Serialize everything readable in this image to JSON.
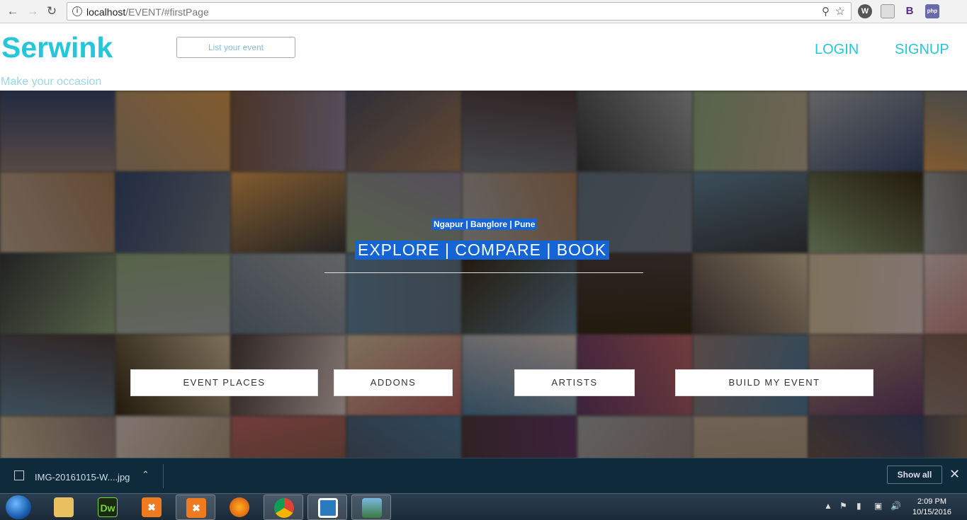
{
  "browser": {
    "url_host": "localhost",
    "url_path": "/EVENT/#firstPage",
    "extensions": [
      "wordpress-icon",
      "page-icon",
      "bootstrap-icon",
      "php-icon"
    ],
    "ext_b_label": "B",
    "ext_php_label": "php"
  },
  "header": {
    "logo": "Serwink",
    "tagline": "Make your occasion",
    "list_event": "List your event",
    "login": "LOGIN",
    "signup": "SIGNUP"
  },
  "hero": {
    "cities": "Ngapur | Banglore | Pune",
    "slogan": "EXPLORE | COMPARE | BOOK",
    "buttons": [
      "EVENT PLACES",
      "ADDONS",
      "ARTISTS",
      "BUILD MY EVENT"
    ]
  },
  "download_bar": {
    "file_name": "IMG-20161015-W....jpg",
    "show_all": "Show all"
  },
  "taskbar": {
    "apps": [
      "file-explorer-icon",
      "dreamweaver-icon",
      "xampp-icon",
      "xampp-icon",
      "firefox-icon",
      "chrome-icon",
      "brackets-icon",
      "photo-viewer-icon"
    ],
    "dw_label": "Dw",
    "time": "2:09 PM",
    "date": "10/15/2016"
  },
  "colors": {
    "brand": "#24c6da",
    "selection": "#1464d6",
    "download_bar": "#0f2a3a",
    "tiles": [
      "#6b5a55",
      "#2a3550",
      "#7a7a7a",
      "#8a4a4a",
      "#3a2a2a",
      "#555a60",
      "#3a2e2c",
      "#7a6a55",
      "#a0703a",
      "#4a5560",
      "#3a5a70",
      "#777",
      "#2a2a2a",
      "#9a8a70",
      "#5a4030",
      "#6a6070",
      "#4a6070",
      "#4a2a4a",
      "#8a7a6a",
      "#6a7a5a",
      "#a0908a",
      "#3a3a44",
      "#7a5a40",
      "#2a2010"
    ]
  }
}
